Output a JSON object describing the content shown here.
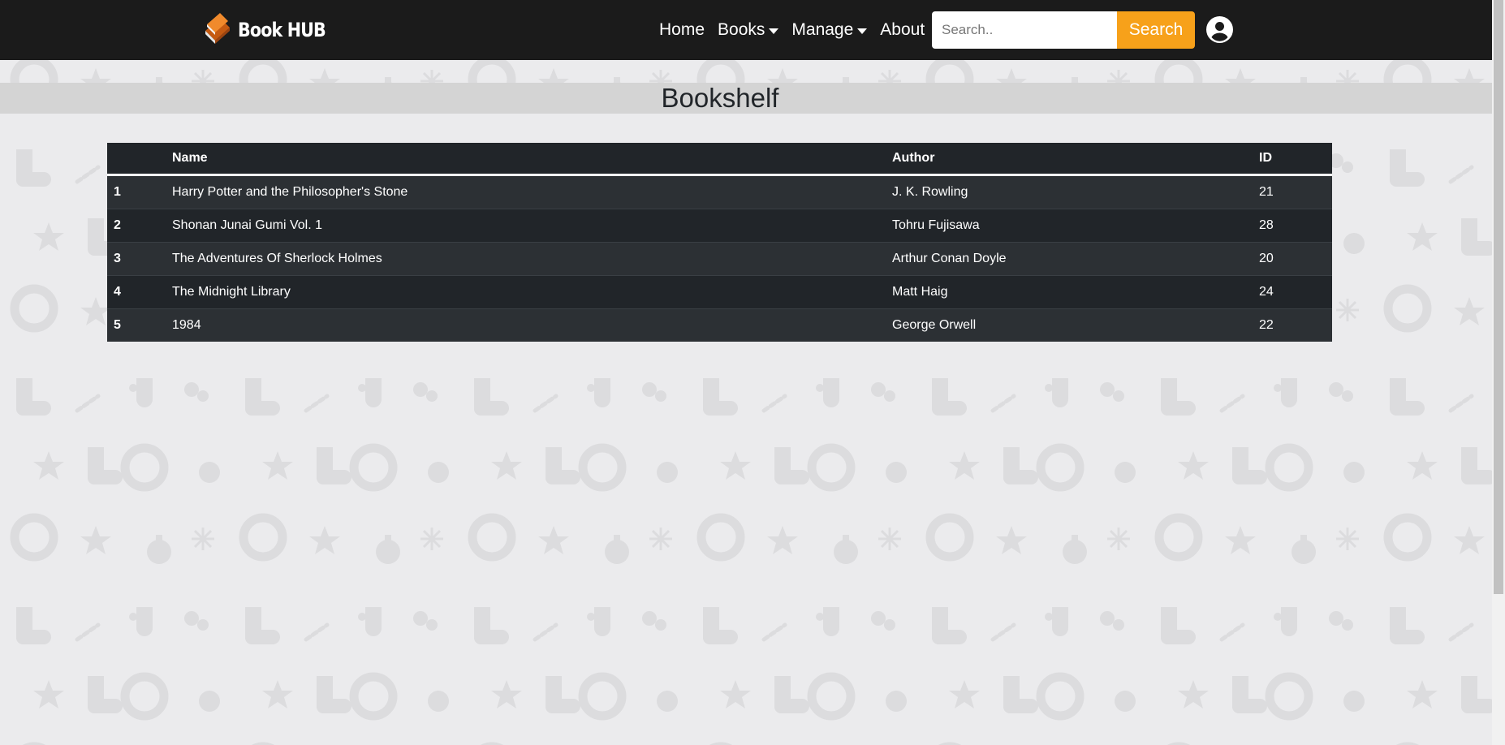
{
  "brand": {
    "name": "Book HUB"
  },
  "nav": {
    "items": [
      {
        "label": "Home",
        "dropdown": false
      },
      {
        "label": "Books",
        "dropdown": true
      },
      {
        "label": "Manage",
        "dropdown": true
      },
      {
        "label": "About",
        "dropdown": false
      }
    ]
  },
  "search": {
    "placeholder": "Search..",
    "value": "",
    "button_label": "Search"
  },
  "page": {
    "title": "Bookshelf"
  },
  "table": {
    "headers": [
      "",
      "Name",
      "Author",
      "ID"
    ],
    "rows": [
      {
        "num": "1",
        "name": "Harry Potter and the Philosopher's Stone",
        "author": "J. K. Rowling",
        "id": "21"
      },
      {
        "num": "2",
        "name": "Shonan Junai Gumi Vol. 1",
        "author": "Tohru Fujisawa",
        "id": "28"
      },
      {
        "num": "3",
        "name": "The Adventures Of Sherlock Holmes",
        "author": "Arthur Conan Doyle",
        "id": "20"
      },
      {
        "num": "4",
        "name": "The Midnight Library",
        "author": "Matt Haig",
        "id": "24"
      },
      {
        "num": "5",
        "name": "1984",
        "author": "George Orwell",
        "id": "22"
      }
    ]
  },
  "colors": {
    "navbar": "#1b1b1b",
    "accent": "#f7a11a",
    "page_background": "#ebebed",
    "title_bar": "#d4d4d4",
    "table_dark": "#212529",
    "table_stripe": "#2c3034"
  },
  "icons": {
    "logo": "book-stack-icon",
    "dropdown": "caret-down-icon",
    "user": "user-circle-icon"
  }
}
